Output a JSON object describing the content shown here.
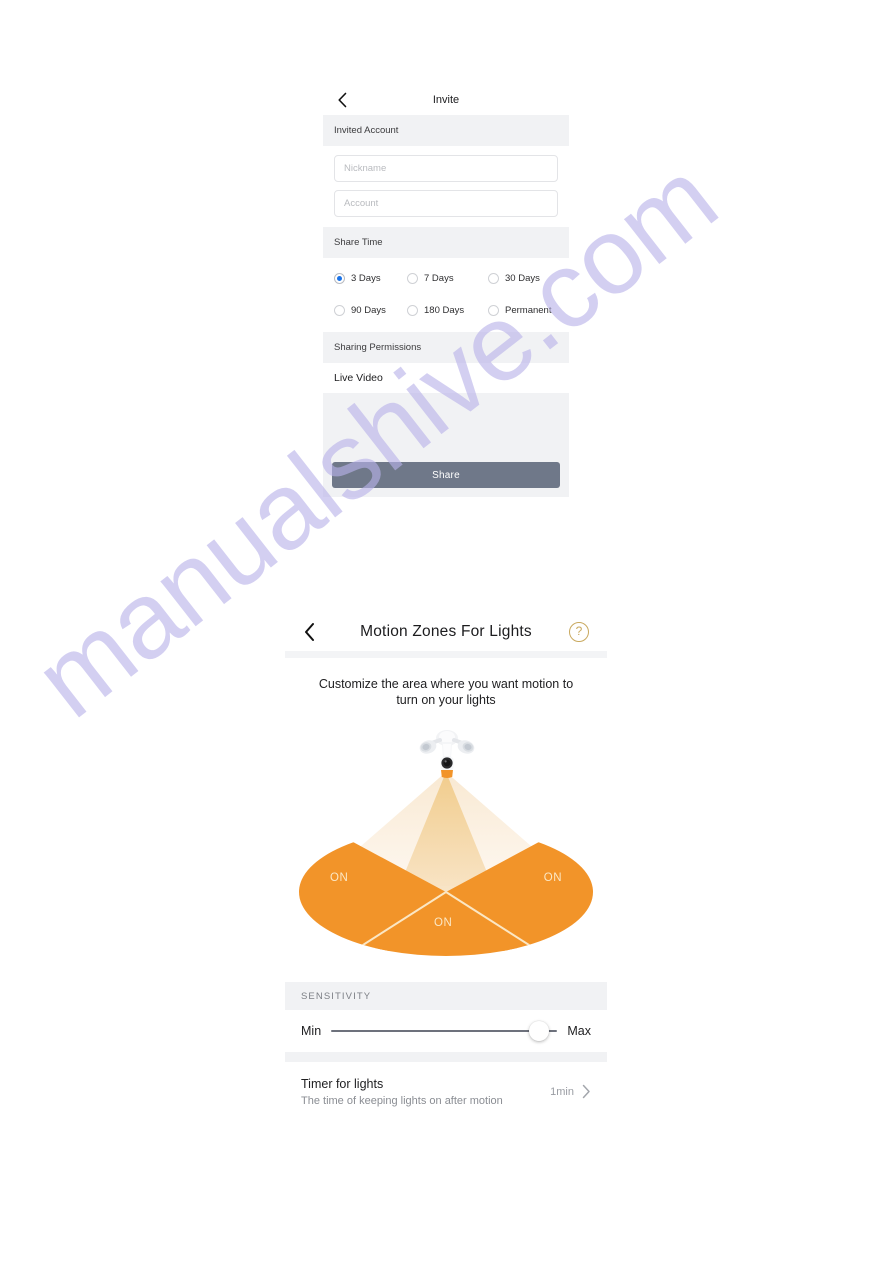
{
  "watermark": {
    "text": "manualshive.com"
  },
  "screen_invite": {
    "nav": {
      "back_icon": "chevron-left-icon",
      "title": "Invite"
    },
    "section_invited_account": {
      "title": "Invited Account"
    },
    "fields": {
      "nickname": {
        "value": "",
        "placeholder": "Nickname"
      },
      "account": {
        "value": "",
        "placeholder": "Account"
      }
    },
    "section_share_time": {
      "title": "Share Time"
    },
    "share_time_options": [
      {
        "label": "3 Days",
        "selected": true
      },
      {
        "label": "7 Days",
        "selected": false
      },
      {
        "label": "30 Days",
        "selected": false
      },
      {
        "label": "90 Days",
        "selected": false
      },
      {
        "label": "180 Days",
        "selected": false
      },
      {
        "label": "Permanent",
        "selected": false
      }
    ],
    "section_sharing_permissions": {
      "title": "Sharing Permissions"
    },
    "permissions": [
      {
        "label": "Live Video"
      }
    ],
    "share_button": {
      "label": "Share",
      "color": "#6f7889"
    }
  },
  "screen_motion_zones": {
    "nav": {
      "back_icon": "chevron-left-icon",
      "title": "Motion Zones For Lights",
      "help_icon": "question-circle-icon",
      "help_glyph": "?"
    },
    "caption": "Customize the area where you want motion to turn on your lights",
    "device_icon": "floodlight-camera-icon",
    "zones": [
      {
        "name": "left-zone",
        "label": "ON",
        "state": "on"
      },
      {
        "name": "right-zone",
        "label": "ON",
        "state": "on"
      },
      {
        "name": "bottom-zone",
        "label": "ON",
        "state": "on"
      }
    ],
    "zone_colors": {
      "zone_on": "#f29429",
      "beam_center": "#f3d4a0",
      "beam_side": "#faeada",
      "divider": "#fbe7c4"
    },
    "sensitivity": {
      "header": "SENSITIVITY",
      "min_label": "Min",
      "max_label": "Max",
      "value_percent": 92
    },
    "timer": {
      "title": "Timer for lights",
      "subtitle": "The time of keeping lights on after motion",
      "value": "1min",
      "chevron_icon": "chevron-right-icon"
    }
  }
}
